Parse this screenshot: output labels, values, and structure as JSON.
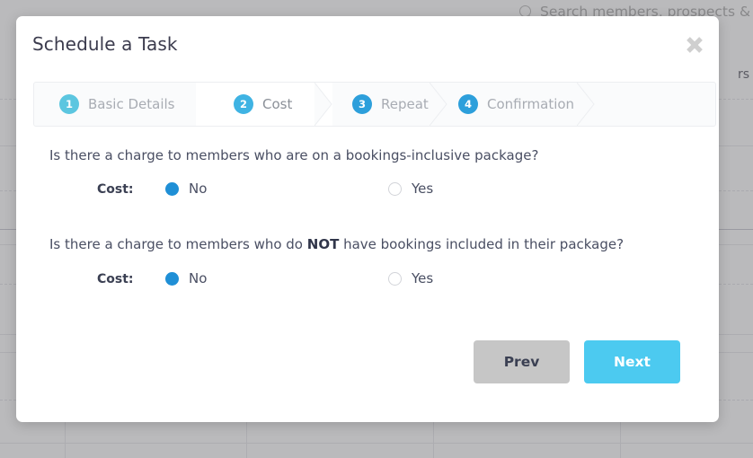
{
  "background": {
    "search_placeholder": "Search members, prospects & s",
    "search_icon": "search-icon",
    "cut_off_label": "rs"
  },
  "modal": {
    "title": "Schedule a Task",
    "close_icon": "close-icon",
    "steps": [
      {
        "num": "1",
        "label": "Basic Details",
        "active": false,
        "color": "#5cc6e0"
      },
      {
        "num": "2",
        "label": "Cost",
        "active": true,
        "color": "#3fb3e3"
      },
      {
        "num": "3",
        "label": "Repeat",
        "active": false,
        "color": "#2d9fdb"
      },
      {
        "num": "4",
        "label": "Confirmation",
        "active": false,
        "color": "#2d9fdb"
      }
    ],
    "questions": [
      {
        "text_before": "Is there a charge to members who are on a bookings-inclusive package?",
        "text_bold": "",
        "text_after": "",
        "cost_label": "Cost:",
        "options": [
          {
            "label": "No",
            "selected": true
          },
          {
            "label": "Yes",
            "selected": false
          }
        ]
      },
      {
        "text_before": "Is there a charge to members who do ",
        "text_bold": "NOT",
        "text_after": " have bookings included in their package?",
        "cost_label": "Cost:",
        "options": [
          {
            "label": "No",
            "selected": true
          },
          {
            "label": "Yes",
            "selected": false
          }
        ]
      }
    ],
    "buttons": {
      "prev_label": "Prev",
      "next_label": "Next",
      "prev_color": "#c6c6c6",
      "next_color": "#4ccaf0"
    }
  }
}
